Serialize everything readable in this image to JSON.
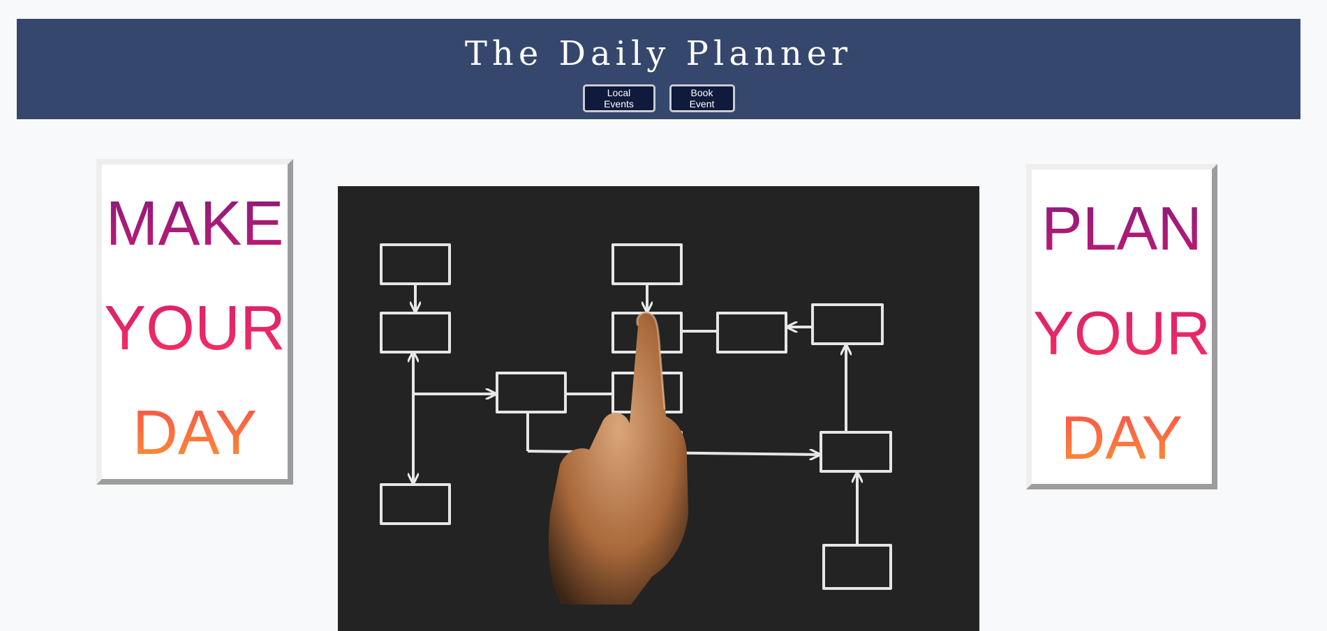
{
  "header": {
    "title": "The Daily Planner",
    "nav": {
      "local_events_label": "Local Events",
      "book_event_label": "Book Event"
    }
  },
  "left_poster": {
    "lines": [
      "MAKE",
      "YOUR",
      "DAY"
    ]
  },
  "right_poster": {
    "lines": [
      "PLAN",
      "YOUR",
      "DAY"
    ]
  },
  "hero_image": {
    "description_icon": "flowchart-hand-icon"
  },
  "colors": {
    "header_bg": "#36476d",
    "button_bg": "#0f1a3c",
    "gradient_start": "#7b1c7e",
    "gradient_mid": "#ef2a64",
    "gradient_end": "#faa62b",
    "page_bg": "#f8f9fb"
  }
}
